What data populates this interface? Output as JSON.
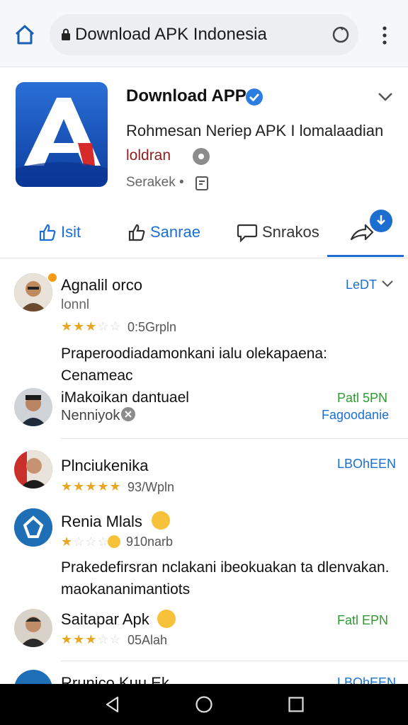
{
  "browser": {
    "url_text": "Download APK Indonesia"
  },
  "app": {
    "title": "Download APP",
    "description": "Rohmesan Neriep APK I lomalaadian",
    "developer": "loldran",
    "meta": "Serakek •"
  },
  "tabs": [
    {
      "label": "Isit"
    },
    {
      "label": "Sanrae"
    },
    {
      "label": "Snrakos"
    }
  ],
  "reviews": [
    {
      "name": "Agnalil orco",
      "subtitle": "lonnl",
      "rating": 3,
      "meta": "0:5Grpln",
      "tag": "LeDT",
      "text_line1": "Praperoodiadamonkani ialu olekapaena: Cenameac",
      "text_line2": "iMakoikan dantuael"
    },
    {
      "name": "Nenniyok",
      "tag_line1": "Patl 5PN",
      "tag_line2": "Fagoodanie"
    },
    {
      "name": "Plnciukenika",
      "rating": 5,
      "meta": "93/Wpln",
      "tag": "LBOhEEN"
    },
    {
      "name": "Renia Mlals",
      "rating": 1,
      "meta": "910narb",
      "text_line1": "Prakedefirsran nclakani ibeokuakan ta dlenvakan.",
      "text_line2": "maokananimantiots"
    },
    {
      "name": "Saitapar Apk",
      "rating": 3,
      "meta": "05Alah",
      "tag": "Fatl EPN"
    },
    {
      "name": "Rrunico Kuu Ek",
      "tag": "LBOhEEN"
    }
  ],
  "colors": {
    "accent": "#1c6fd1",
    "star": "#e9a620",
    "green": "#2f9a2f"
  }
}
